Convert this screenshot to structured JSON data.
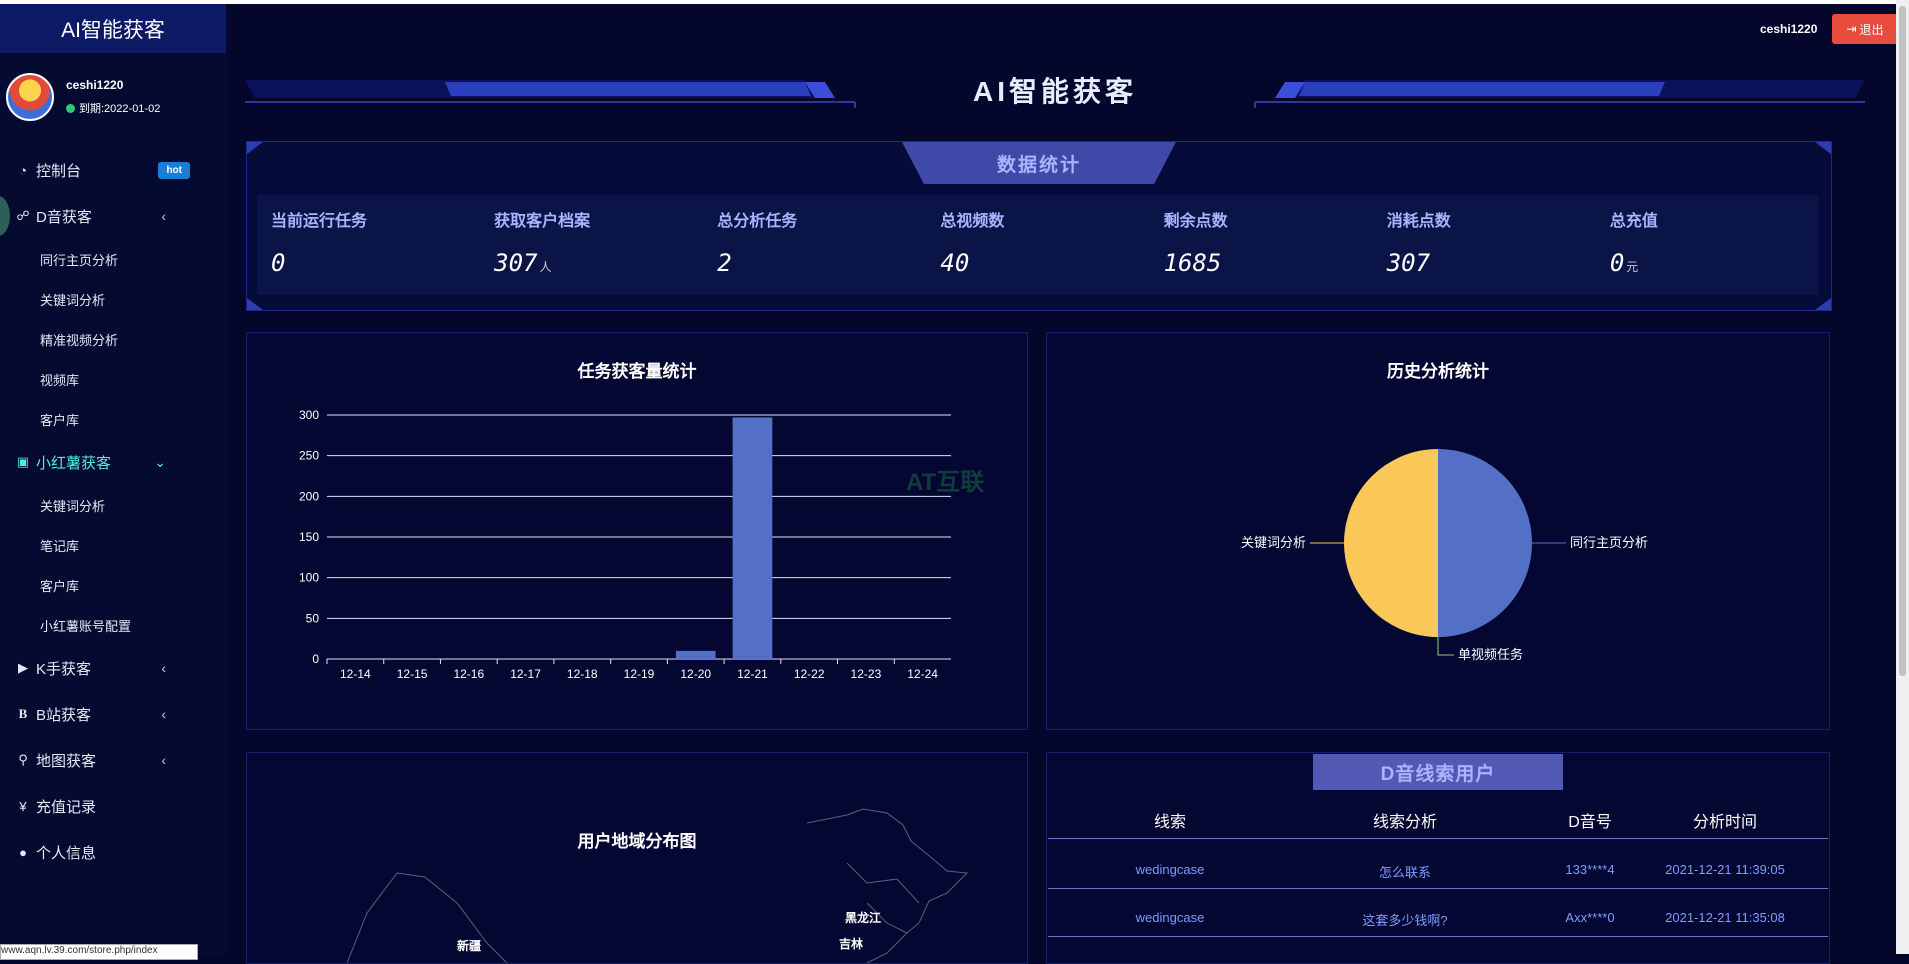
{
  "brand": "AI智能获客",
  "user": {
    "name": "ceshi1220",
    "expiry": "到期:2022-01-02"
  },
  "topbar": {
    "user": "ceshi1220",
    "logout": "退出"
  },
  "menu": {
    "console": {
      "label": "控制台",
      "badge": "hot"
    },
    "douyin": {
      "label": "D音获客",
      "subs": [
        "同行主页分析",
        "关键词分析",
        "精准视频分析",
        "视频库",
        "客户库"
      ]
    },
    "xhs": {
      "label": "小红薯获客",
      "subs": [
        "关键词分析",
        "笔记库",
        "客户库",
        "小红薯账号配置"
      ]
    },
    "kuaishou": {
      "label": "K手获客"
    },
    "bili": {
      "label": "B站获客"
    },
    "map": {
      "label": "地图获客"
    },
    "recharge": {
      "label": "充值记录"
    },
    "profile": {
      "label": "个人信息"
    }
  },
  "header": {
    "title": "AI智能获客"
  },
  "stats": {
    "tab": "数据统计",
    "items": [
      {
        "label": "当前运行任务",
        "value": "0",
        "unit": ""
      },
      {
        "label": "获取客户档案",
        "value": "307",
        "unit": "人"
      },
      {
        "label": "总分析任务",
        "value": "2",
        "unit": ""
      },
      {
        "label": "总视频数",
        "value": "40",
        "unit": ""
      },
      {
        "label": "剩余点数",
        "value": "1685",
        "unit": ""
      },
      {
        "label": "消耗点数",
        "value": "307",
        "unit": ""
      },
      {
        "label": "总充值",
        "value": "0",
        "unit": "元"
      }
    ]
  },
  "chart_data": [
    {
      "type": "bar",
      "title": "任务获客量统计",
      "categories": [
        "12-14",
        "12-15",
        "12-16",
        "12-17",
        "12-18",
        "12-19",
        "12-20",
        "12-21",
        "12-22",
        "12-23",
        "12-24"
      ],
      "values": [
        0,
        0,
        0,
        0,
        0,
        0,
        10,
        297,
        0,
        0,
        0
      ],
      "ylim": [
        0,
        300
      ],
      "yticks": [
        0,
        50,
        100,
        150,
        200,
        250,
        300
      ],
      "color": "#5470c6",
      "grid": true
    },
    {
      "type": "pie",
      "title": "历史分析统计",
      "slices": [
        {
          "label": "同行主页分析",
          "value": 1,
          "color": "#5470c6"
        },
        {
          "label": "单视频任务",
          "value": 0,
          "color": "#91cc75"
        },
        {
          "label": "关键词分析",
          "value": 1,
          "color": "#fac858"
        }
      ]
    }
  ],
  "watermark": "AT互联",
  "map": {
    "title": "用户地域分布图",
    "labels": [
      "黑龙江",
      "吉林",
      "新疆"
    ]
  },
  "table": {
    "tab": "D音线索用户",
    "headers": [
      "线索",
      "线索分析",
      "D音号",
      "分析时间"
    ],
    "rows": [
      [
        "wedingcase",
        "怎么联系",
        "133****4",
        "2021-12-21 11:39:05"
      ],
      [
        "wedingcase",
        "这套多少钱啊?",
        "Axx****0",
        "2021-12-21 11:35:08"
      ]
    ]
  },
  "statusbar": "www.aqn.lv.39.com/store.php/index"
}
